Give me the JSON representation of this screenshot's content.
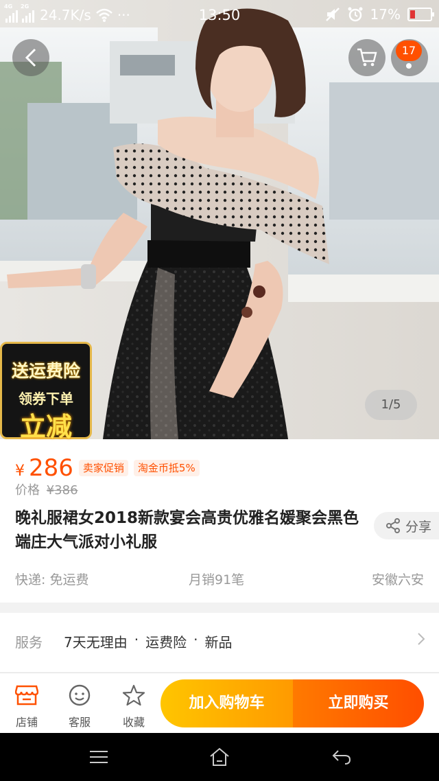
{
  "status_bar": {
    "network_speed": "24.7K/s",
    "net_tag_1": "4G",
    "net_tag_2": "2G",
    "more": "···",
    "time": "13:50",
    "battery": "17%"
  },
  "hero": {
    "page_indicator": "1/5",
    "cart_badge": "17",
    "promo_line1": "送运费险",
    "promo_line2": "领券下单",
    "promo_line3": "立减"
  },
  "product": {
    "currency": "¥",
    "price": "286",
    "tags": [
      "卖家促销",
      "淘金币抵5%"
    ],
    "original_label": "价格",
    "original_price": "¥386",
    "title": "晚礼服裙女2018新款宴会高贵优雅名媛聚会黑色端庄大气派对小礼服",
    "share_label": "分享",
    "shipping": "快递: 免运费",
    "monthly_sales": "月销91笔",
    "location": "安徽六安"
  },
  "service": {
    "label": "服务",
    "items": [
      "7天无理由",
      "运费险",
      "新品"
    ],
    "separator": "·"
  },
  "action_bar": {
    "store_label": "店铺",
    "service_label": "客服",
    "favorite_label": "收藏",
    "add_to_cart": "加入购物车",
    "buy_now": "立即购买"
  },
  "colors": {
    "accent": "#ff5000",
    "cart_button": "#ffb300",
    "buy_button": "#ff5a00"
  }
}
